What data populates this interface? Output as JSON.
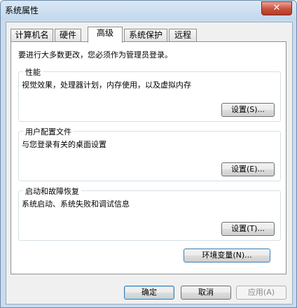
{
  "window": {
    "title": "系统属性",
    "close_label": "✕"
  },
  "tabs": [
    {
      "label": "计算机名",
      "active": false
    },
    {
      "label": "硬件",
      "active": false
    },
    {
      "label": "高级",
      "active": true
    },
    {
      "label": "系统保护",
      "active": false
    },
    {
      "label": "远程",
      "active": false
    }
  ],
  "panel": {
    "intro": "要进行大多数更改，您必须作为管理员登录。",
    "performance": {
      "title": "性能",
      "desc": "视觉效果，处理器计划，内存使用，以及虚拟内存",
      "button": "设置(S)..."
    },
    "profiles": {
      "title": "用户配置文件",
      "desc": "与您登录有关的桌面设置",
      "button": "设置(E)..."
    },
    "startup": {
      "title": "启动和故障恢复",
      "desc": "系统启动、系统失败和调试信息",
      "button": "设置(T)..."
    },
    "env_button": "环境变量(N)..."
  },
  "footer": {
    "ok": "确定",
    "cancel": "取消",
    "apply": "应用(A)"
  }
}
